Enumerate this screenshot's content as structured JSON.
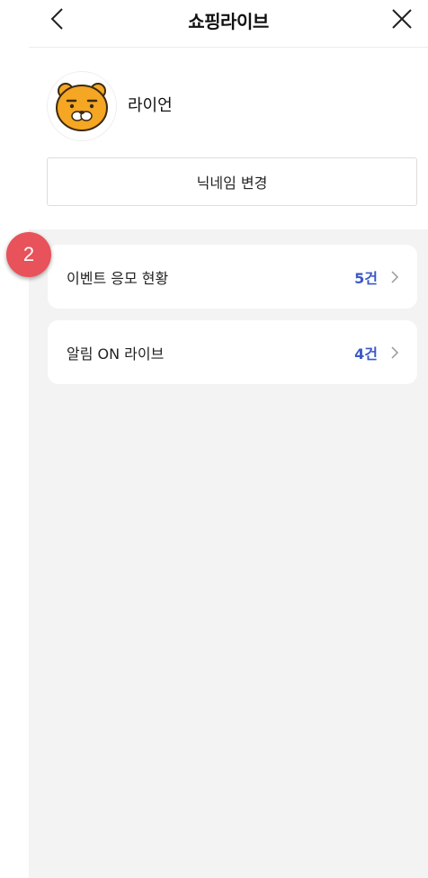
{
  "header": {
    "title": "쇼핑라이브"
  },
  "profile": {
    "nickname": "라이언",
    "change_nickname_label": "닉네임 변경"
  },
  "menu": [
    {
      "label": "이벤트 응모 현황",
      "count": "5건"
    },
    {
      "label": "알림 ON 라이브",
      "count": "4건"
    }
  ],
  "step_badge": "2",
  "colors": {
    "accent": "#3b59c4",
    "badge": "#e8525a",
    "background": "#f3f3f3",
    "avatar_face": "#f5a623"
  },
  "icons": {
    "back": "chevron-left-icon",
    "close": "close-icon",
    "chevron": "chevron-right-icon",
    "avatar": "ryan-character-icon"
  }
}
